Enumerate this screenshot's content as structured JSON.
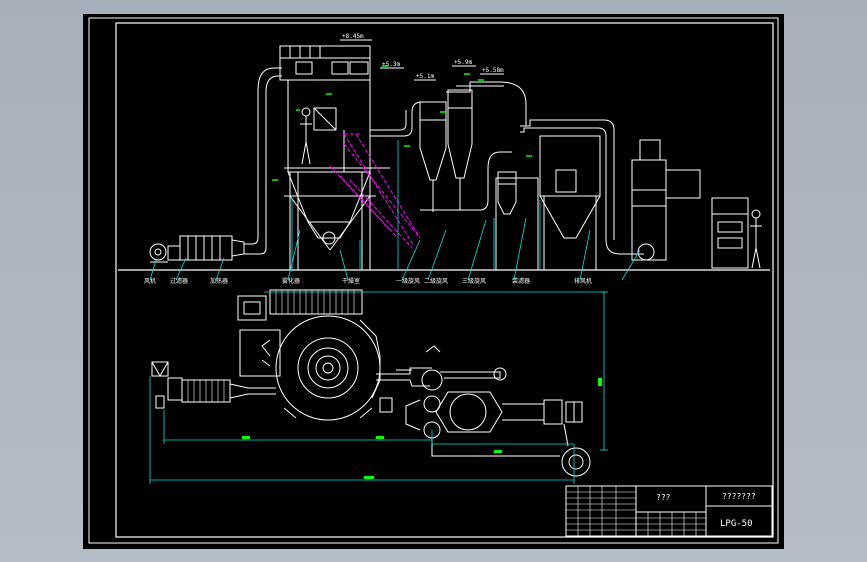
{
  "drawing": {
    "colors": {
      "background": "#000000",
      "line": "#ffffff",
      "dimension": "#00e5e5",
      "hidden": "#ff00ff",
      "mark": "#00ff00",
      "frame": "#ffffff"
    },
    "elevations": [
      "+8.45m",
      "+5.3m",
      "+5.9m",
      "+5.1m",
      "+5.58m"
    ],
    "equipment_labels": [
      "风机",
      "过滤器",
      "加热器",
      "雾化器",
      "干燥室",
      "一级旋风",
      "二级旋风",
      "三级旋风",
      "袋滤器",
      "排风机"
    ],
    "title_block": {
      "name": "???",
      "company": "???????",
      "drawing_no": "LPG-50"
    }
  }
}
